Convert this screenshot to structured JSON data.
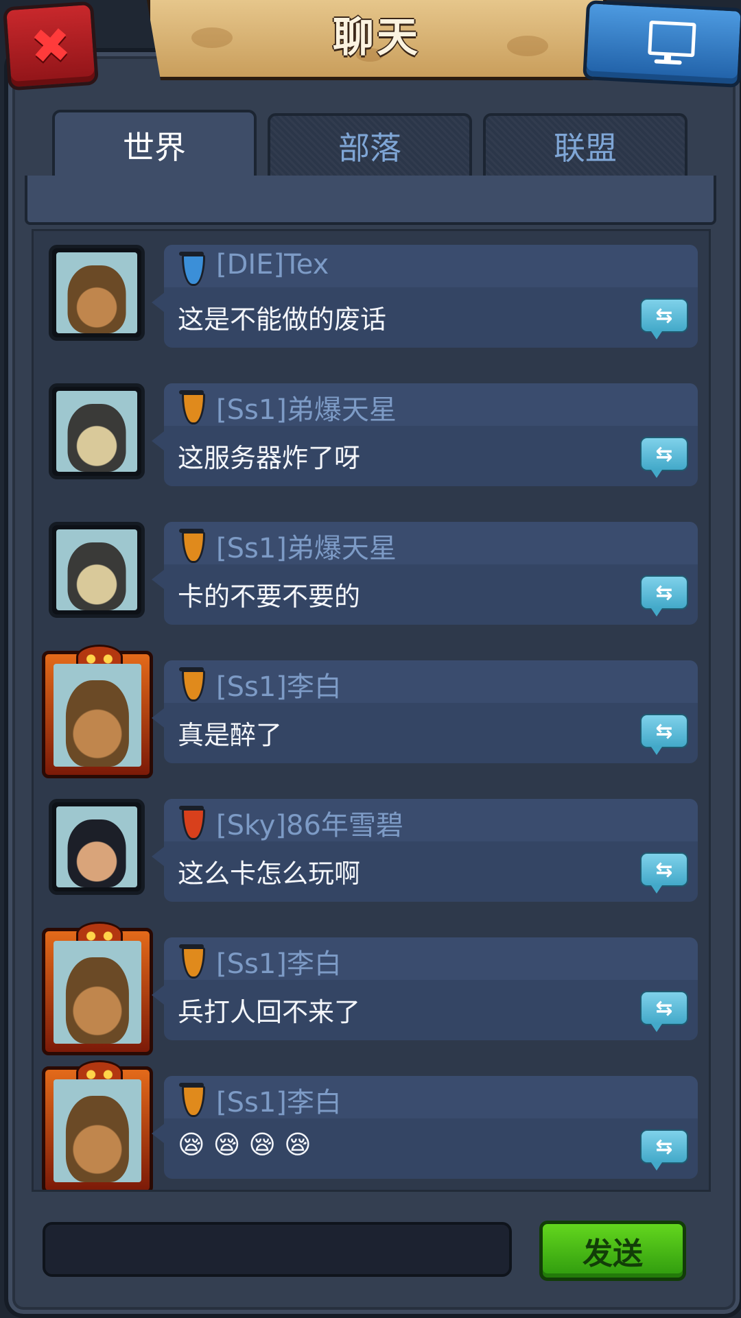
{
  "title": "聊天",
  "tabs": [
    {
      "label": "世界",
      "active": true
    },
    {
      "label": "部落",
      "active": false
    },
    {
      "label": "联盟",
      "active": false
    }
  ],
  "messages": [
    {
      "sender": "[DIE]Tex",
      "text": "这是不能做的废话",
      "badge_color": "#3b8fd8",
      "avatar": "bearded-warrior-icon",
      "frame": "plain"
    },
    {
      "sender": "[Ss1]弟爆天星",
      "text": "这服务器炸了呀",
      "badge_color": "#e08a1c",
      "avatar": "beast-icon",
      "frame": "plain"
    },
    {
      "sender": "[Ss1]弟爆天星",
      "text": "卡的不要不要的",
      "badge_color": "#e08a1c",
      "avatar": "beast-icon",
      "frame": "plain"
    },
    {
      "sender": "[Ss1]李白",
      "text": "真是醉了",
      "badge_color": "#e08a1c",
      "avatar": "bearded-warrior-icon",
      "frame": "fire"
    },
    {
      "sender": "[Sky]86年雪碧",
      "text": "这么卡怎么玩啊",
      "badge_color": "#d8401c",
      "avatar": "hero-icon",
      "frame": "plain"
    },
    {
      "sender": "[Ss1]李白",
      "text": "兵打人回不来了",
      "badge_color": "#e08a1c",
      "avatar": "bearded-warrior-icon",
      "frame": "fire"
    },
    {
      "sender": "[Ss1]李白",
      "text": "😪 😪 😪 😪",
      "badge_color": "#e08a1c",
      "avatar": "bearded-warrior-icon",
      "frame": "fire"
    }
  ],
  "translate_icon": "⇆",
  "input": {
    "value": "",
    "placeholder": ""
  },
  "send_label": "发送"
}
